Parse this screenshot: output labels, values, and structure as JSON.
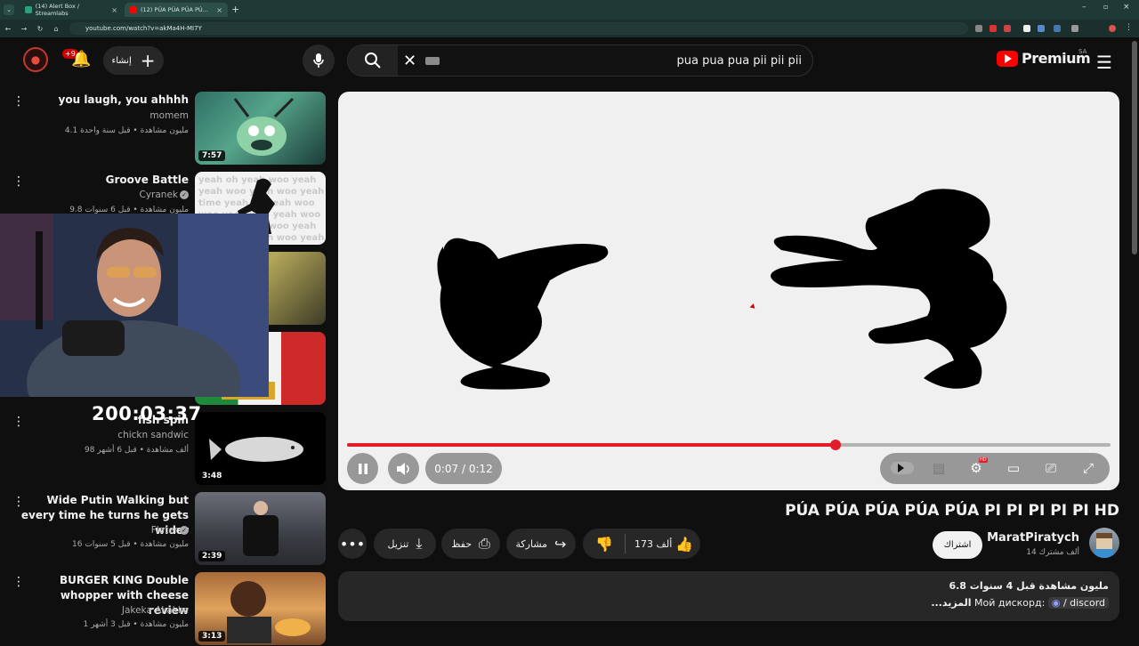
{
  "browser": {
    "tabs": [
      {
        "label": "(14) Alert Box / Streamlabs",
        "color": "#2aa37a"
      },
      {
        "label": "(12) PÚA PÚA PÚA PÚ...",
        "color": "#ff0000"
      }
    ],
    "url": "youtube.com/watch?v=akMa4H-MI7Y"
  },
  "header": {
    "notification_badge": "+9",
    "create_label": "إنشاء",
    "search_query": "pua pua pua pii pii pii",
    "logo_word": "Premium",
    "country_code": "SA"
  },
  "sidebar": {
    "items": [
      {
        "title": "you laugh, you ahhhh",
        "channel": "momem",
        "meta": "4.1 مليون مشاهدة • قبل سنة واحدة",
        "duration": "7:57"
      },
      {
        "title": "Groove Battle",
        "channel": "Cyranek",
        "meta": "9.8 مليون مشاهدة • قبل 6 سنوات",
        "duration": ""
      },
      {
        "title": "",
        "channel": "",
        "meta": "",
        "duration": ""
      },
      {
        "title": "",
        "channel": "",
        "meta": "",
        "duration": ""
      },
      {
        "title": "fish spin",
        "channel": "chickn sandwic",
        "meta": "98 ألف مشاهدة • قبل 6 أشهر",
        "duration": "3:48"
      },
      {
        "title": "Wide Putin Walking but every time he turns he gets wider",
        "channel": "Flater",
        "meta": "16 مليون مشاهدة • قبل 5 سنوات",
        "duration": "2:39"
      },
      {
        "title": "BURGER KING Double whopper with cheese review",
        "channel": "Jakeka Akakke",
        "meta": "1 مليون مشاهدة • قبل 3 أشهر",
        "duration": "3:13"
      }
    ]
  },
  "overlay": {
    "stream_timer": "200:03:37"
  },
  "player": {
    "current_time": "0:07",
    "duration": "0:12",
    "time_display": "0:07 / 0:12",
    "progress": 0.64,
    "accent": "#e21d2a"
  },
  "video": {
    "title": "PÚA PÚA PÚA PÚA PÚA PI PI PI PI PI HD",
    "channel": "MaratPiratych",
    "subscribers": "14 ألف مشترك",
    "subscribe_label": "اشتراك",
    "likes": "173 ألف",
    "share_label": "مشاركة",
    "save_label": "حفظ",
    "download_label": "تنزيل",
    "views_line": "6.8 مليون مشاهدة  قبل 4 سنوات",
    "description_text": "Мой дискорд:",
    "description_link": "/ discord",
    "more_label": "...المزيد"
  }
}
